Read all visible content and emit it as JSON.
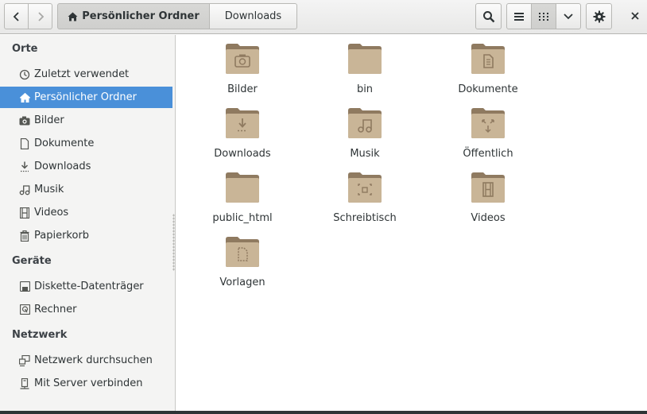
{
  "header": {
    "breadcrumb_home": "Persönlicher Ordner",
    "breadcrumb_current": "Downloads"
  },
  "sidebar": {
    "sections": [
      {
        "title": "Orte"
      },
      {
        "title": "Geräte"
      },
      {
        "title": "Netzwerk"
      }
    ],
    "items": [
      {
        "label": "Zuletzt verwendet",
        "icon": "clock-icon"
      },
      {
        "label": "Persönlicher Ordner",
        "icon": "home-icon"
      },
      {
        "label": "Bilder",
        "icon": "camera-icon"
      },
      {
        "label": "Dokumente",
        "icon": "document-icon"
      },
      {
        "label": "Downloads",
        "icon": "download-icon"
      },
      {
        "label": "Musik",
        "icon": "music-icon"
      },
      {
        "label": "Videos",
        "icon": "film-icon"
      },
      {
        "label": "Papierkorb",
        "icon": "trash-icon"
      },
      {
        "label": "Diskette-Datenträger",
        "icon": "floppy-icon"
      },
      {
        "label": "Rechner",
        "icon": "computer-icon"
      },
      {
        "label": "Netzwerk durchsuchen",
        "icon": "network-icon"
      },
      {
        "label": "Mit Server verbinden",
        "icon": "server-icon"
      }
    ],
    "active_item": "Persönlicher Ordner"
  },
  "files": [
    {
      "name": "Bilder",
      "emblem": "camera"
    },
    {
      "name": "bin",
      "emblem": "none"
    },
    {
      "name": "Dokumente",
      "emblem": "document"
    },
    {
      "name": "Downloads",
      "emblem": "download"
    },
    {
      "name": "Musik",
      "emblem": "music"
    },
    {
      "name": "Öffentlich",
      "emblem": "share"
    },
    {
      "name": "public_html",
      "emblem": "none"
    },
    {
      "name": "Schreibtisch",
      "emblem": "desktop"
    },
    {
      "name": "Videos",
      "emblem": "film"
    },
    {
      "name": "Vorlagen",
      "emblem": "template"
    }
  ],
  "colors": {
    "accent": "#4a90d9",
    "folder": "#b39a7c",
    "folder_dark": "#8f7a60"
  },
  "view_mode": "grid"
}
